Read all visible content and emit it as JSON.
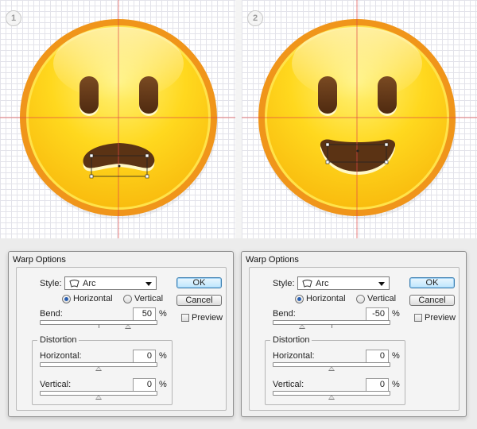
{
  "steps": [
    "1",
    "2"
  ],
  "colors": {
    "face_outer": "#f09b1e",
    "face_inner": "#ffd21c",
    "mouth": "#5e3517",
    "guide": "#e24646"
  },
  "dialogs": [
    {
      "title": "Warp Options",
      "style_label": "Style:",
      "style_value": "Arc",
      "style_icon": "arc-warp-icon",
      "horizontal_label": "Horizontal",
      "vertical_label": "Vertical",
      "orientation_selected": "Horizontal",
      "bend_label": "Bend:",
      "bend_value": "50",
      "bend_unit": "%",
      "bend_slider_fraction": 0.75,
      "distortion_label": "Distortion",
      "dist_horizontal_label": "Horizontal:",
      "dist_horizontal_value": "0",
      "dist_horizontal_unit": "%",
      "dist_vertical_label": "Vertical:",
      "dist_vertical_value": "0",
      "dist_vertical_unit": "%",
      "ok_label": "OK",
      "cancel_label": "Cancel",
      "preview_label": "Preview",
      "preview_checked": false
    },
    {
      "title": "Warp Options",
      "style_label": "Style:",
      "style_value": "Arc",
      "style_icon": "arc-warp-icon",
      "horizontal_label": "Horizontal",
      "vertical_label": "Vertical",
      "orientation_selected": "Horizontal",
      "bend_label": "Bend:",
      "bend_value": "-50",
      "bend_unit": "%",
      "bend_slider_fraction": 0.25,
      "distortion_label": "Distortion",
      "dist_horizontal_label": "Horizontal:",
      "dist_horizontal_value": "0",
      "dist_horizontal_unit": "%",
      "dist_vertical_label": "Vertical:",
      "dist_vertical_value": "0",
      "dist_vertical_unit": "%",
      "ok_label": "OK",
      "cancel_label": "Cancel",
      "preview_label": "Preview",
      "preview_checked": false
    }
  ]
}
